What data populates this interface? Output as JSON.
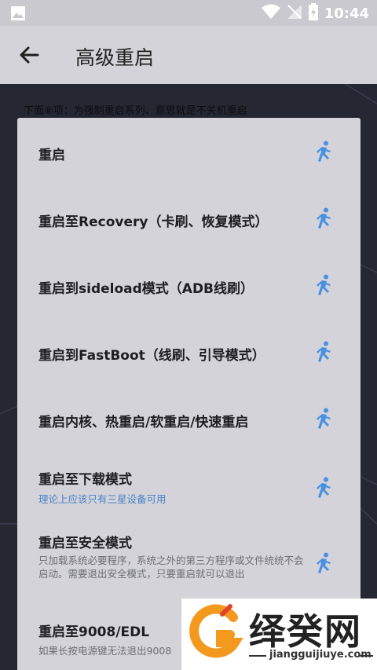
{
  "status_bar": {
    "time": "10:44"
  },
  "app_bar": {
    "title": "高级重启"
  },
  "background": {
    "hint": "下面⑧项：为强制重启系列、意思就是不关机重启"
  },
  "options": [
    {
      "label": "重启"
    },
    {
      "label": "重启至Recovery（卡刷、恢复模式）"
    },
    {
      "label": "重启到sideload模式（ADB线刷）"
    },
    {
      "label": "重启到FastBoot（线刷、引导模式）"
    },
    {
      "label": "重启内核、热重启/软重启/快速重启"
    },
    {
      "label": "重启至下载模式",
      "sub": "理论上应该只有三星设备可用"
    },
    {
      "label": "重启至安全模式",
      "desc": "只加载系统必要程序，系统之外的第三方程序或文件统统不会启动。需要退出安全模式，只要重启就可以退出"
    },
    {
      "label": "重启至9008/EDL",
      "desc": "如果长按电源键无法退出9008"
    }
  ],
  "watermark": {
    "brand": "绎癸网",
    "site": "jiangguijiuye.com"
  },
  "colors": {
    "accent": "#4a90e2",
    "dialog": "#d3d3d9"
  }
}
